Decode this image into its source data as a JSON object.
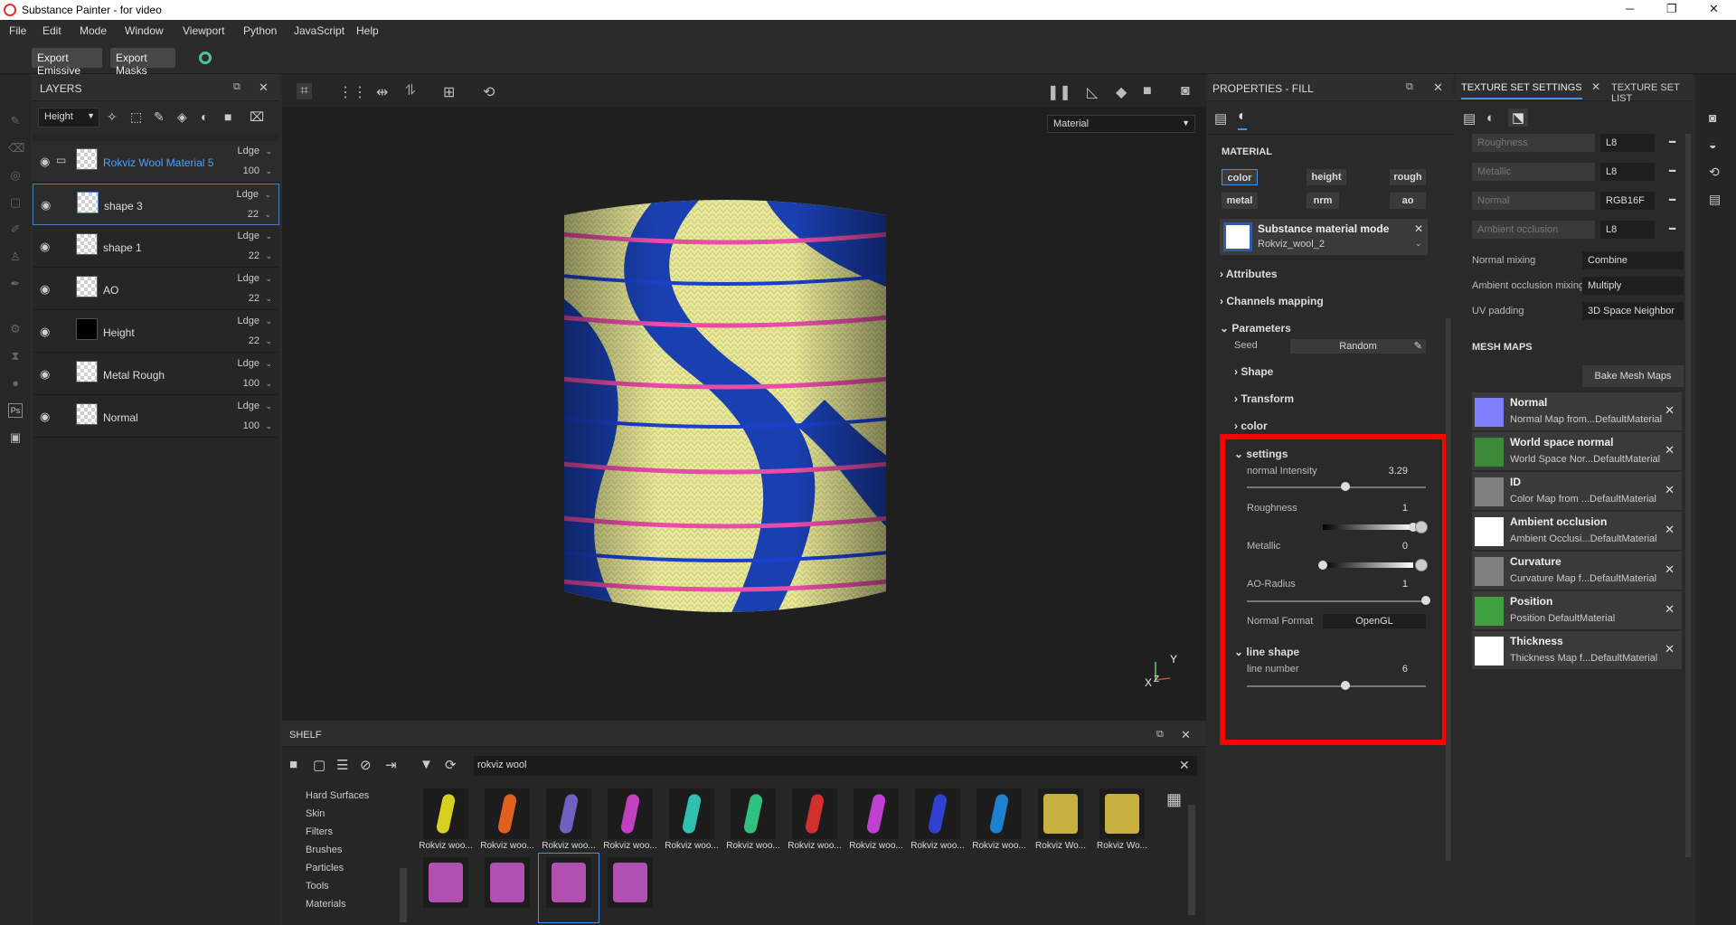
{
  "window": {
    "title": "Substance Painter - for video"
  },
  "menu": [
    "File",
    "Edit",
    "Mode",
    "Window",
    "Viewport",
    "Python",
    "JavaScript",
    "Help"
  ],
  "toolbar": {
    "export_emissive": "Export Emissive",
    "export_masks": "Export Masks"
  },
  "layers": {
    "title": "LAYERS",
    "channel_select": "Height",
    "items": [
      {
        "name": "Rokviz Wool Material 5",
        "blend": "Ldge",
        "opacity": "100",
        "selected": false,
        "folder": true
      },
      {
        "name": "shape 3",
        "blend": "Ldge",
        "opacity": "22",
        "selected": true
      },
      {
        "name": "shape 1",
        "blend": "Ldge",
        "opacity": "22"
      },
      {
        "name": "AO",
        "blend": "Ldge",
        "opacity": "22"
      },
      {
        "name": "Height",
        "blend": "Ldge",
        "opacity": "22"
      },
      {
        "name": "Metal Rough",
        "blend": "Ldge",
        "opacity": "100"
      },
      {
        "name": "Normal",
        "blend": "Ldge",
        "opacity": "100"
      }
    ]
  },
  "viewport": {
    "display_mode": "Material",
    "axis_y": "Y",
    "axis_x": "X",
    "axis_z": "Z"
  },
  "properties": {
    "title": "PROPERTIES - FILL",
    "material_label": "MATERIAL",
    "channels": [
      "color",
      "height",
      "rough",
      "metal",
      "nrm",
      "ao"
    ],
    "substance": {
      "title": "Substance material mode",
      "name": "Rokviz_wool_2"
    },
    "sections": {
      "attributes": "Attributes",
      "channels_mapping": "Channels mapping",
      "parameters": "Parameters"
    },
    "seed_label": "Seed",
    "seed_value": "Random",
    "groups": {
      "shape": "Shape",
      "transform": "Transform",
      "color": "color",
      "settings": "settings",
      "line_shape": "line shape"
    },
    "settings": [
      {
        "label": "normal Intensity",
        "value": "3.29",
        "level": 0.55
      },
      {
        "label": "Roughness",
        "value": "1",
        "level": 1.0
      },
      {
        "label": "Metallic",
        "value": "0",
        "level": 0.0
      },
      {
        "label": "AO-Radius",
        "value": "1",
        "level": 1.0
      }
    ],
    "normal_format_label": "Normal Format",
    "normal_format_value": "OpenGL",
    "line_number_label": "line number",
    "line_number_value": "6",
    "line_number_level": 0.55,
    "highlight_color": "#ff0000"
  },
  "texture_set": {
    "tab_settings": "TEXTURE SET SETTINGS",
    "tab_list": "TEXTURE SET LIST",
    "channels": [
      {
        "name": "Roughness",
        "format": "L8"
      },
      {
        "name": "Metallic",
        "format": "L8"
      },
      {
        "name": "Normal",
        "format": "RGB16F"
      },
      {
        "name": "Ambient occlusion",
        "format": "L8"
      }
    ],
    "normal_mixing_label": "Normal mixing",
    "normal_mixing": "Combine",
    "ao_mixing_label": "Ambient occlusion mixing",
    "ao_mixing": "Multiply",
    "uv_padding_label": "UV padding",
    "uv_padding": "3D Space Neighbor",
    "mesh_maps_title": "MESH MAPS",
    "bake_button": "Bake Mesh Maps",
    "mesh_maps": [
      {
        "title": "Normal",
        "sub": "Normal Map from...DefaultMaterial",
        "color": "#8080ff"
      },
      {
        "title": "World space normal",
        "sub": "World Space Nor...DefaultMaterial",
        "color": "#3a8a3a"
      },
      {
        "title": "ID",
        "sub": "Color Map from ...DefaultMaterial",
        "color": "#808080"
      },
      {
        "title": "Ambient occlusion",
        "sub": "Ambient Occlusi...DefaultMaterial",
        "color": "#ffffff"
      },
      {
        "title": "Curvature",
        "sub": "Curvature Map f...DefaultMaterial",
        "color": "#7f7f7f"
      },
      {
        "title": "Position",
        "sub": "Position DefaultMaterial",
        "color": "#40a040"
      },
      {
        "title": "Thickness",
        "sub": "Thickness Map f...DefaultMaterial",
        "color": "#ffffff"
      }
    ]
  },
  "shelf": {
    "title": "SHELF",
    "search": "rokviz wool",
    "categories": [
      "Hard Surfaces",
      "Skin",
      "Filters",
      "Brushes",
      "Particles",
      "Tools",
      "Materials"
    ],
    "items": [
      {
        "caption": "Rokviz woo...",
        "color": "#d8d020"
      },
      {
        "caption": "Rokviz woo...",
        "color": "#e06020"
      },
      {
        "caption": "Rokviz woo...",
        "color": "#7060c0"
      },
      {
        "caption": "Rokviz woo...",
        "color": "#c040c0"
      },
      {
        "caption": "Rokviz woo...",
        "color": "#30c0b0"
      },
      {
        "caption": "Rokviz woo...",
        "color": "#30c080"
      },
      {
        "caption": "Rokviz woo...",
        "color": "#d03030"
      },
      {
        "caption": "Rokviz woo...",
        "color": "#c040d0"
      },
      {
        "caption": "Rokviz woo...",
        "color": "#3040d0"
      },
      {
        "caption": "Rokviz woo...",
        "color": "#2080d0"
      },
      {
        "caption": "Rokviz Wo...",
        "color": "#c8b040"
      },
      {
        "caption": "Rokviz Wo...",
        "color": "#c8b040"
      },
      {
        "caption": "",
        "color": "#b050b0"
      },
      {
        "caption": "",
        "color": "#b050b0"
      },
      {
        "caption": "",
        "color": "#b050b0"
      },
      {
        "caption": "",
        "color": "#b050b0"
      }
    ]
  }
}
